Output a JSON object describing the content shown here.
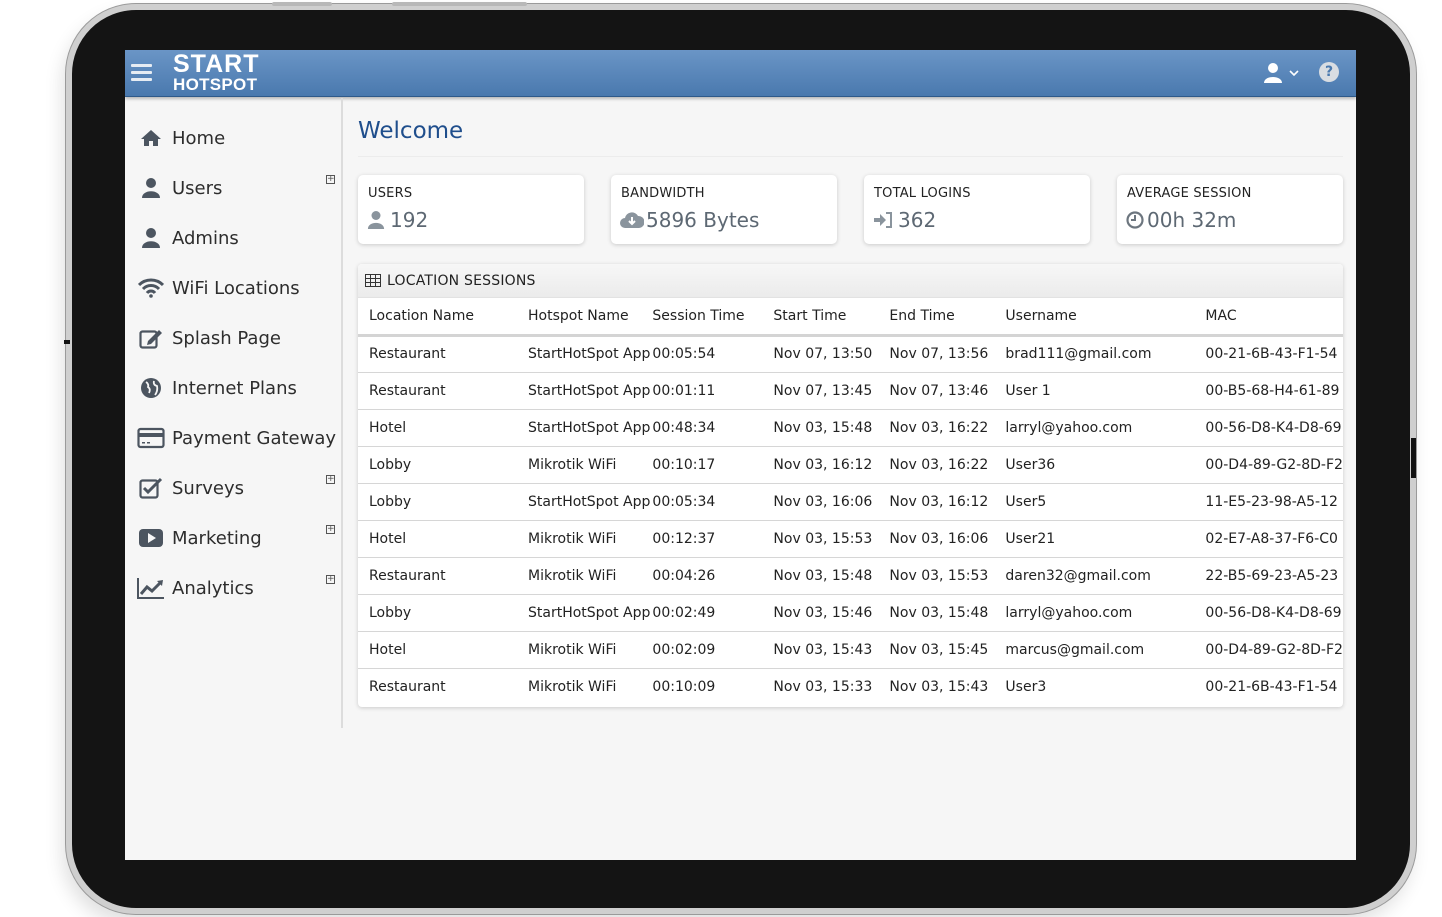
{
  "app": {
    "logo_line1": "START",
    "logo_line2": "HOTSPOT",
    "menu_icon": "hamburger-icon",
    "user_icon": "user-icon",
    "user_dropdown_icon": "chevron-down-icon",
    "help_icon": "question-circle-icon",
    "help_glyph": "?"
  },
  "sidebar": {
    "items": [
      {
        "label": "Home",
        "icon": "home-icon",
        "expandable": false
      },
      {
        "label": "Users",
        "icon": "user-icon",
        "expandable": true
      },
      {
        "label": "Admins",
        "icon": "user-icon",
        "expandable": false
      },
      {
        "label": "WiFi Locations",
        "icon": "wifi-icon",
        "expandable": false
      },
      {
        "label": "Splash Page",
        "icon": "edit-icon",
        "expandable": false
      },
      {
        "label": "Internet Plans",
        "icon": "globe-icon",
        "expandable": false
      },
      {
        "label": "Payment Gateway",
        "icon": "credit-card-icon",
        "expandable": false
      },
      {
        "label": "Surveys",
        "icon": "check-square-icon",
        "expandable": true
      },
      {
        "label": "Marketing",
        "icon": "video-play-icon",
        "expandable": true
      },
      {
        "label": "Analytics",
        "icon": "line-chart-icon",
        "expandable": true
      }
    ],
    "expand_glyph": "+"
  },
  "main": {
    "title": "Welcome",
    "stats": [
      {
        "title": "USERS",
        "value": "192",
        "icon": "user-icon"
      },
      {
        "title": "BANDWIDTH",
        "value": "5896 Bytes",
        "icon": "cloud-download-icon"
      },
      {
        "title": "TOTAL LOGINS",
        "value": "362",
        "icon": "sign-in-icon"
      },
      {
        "title": "AVERAGE SESSION",
        "value": "00h 32m",
        "icon": "clock-icon"
      }
    ],
    "sessions": {
      "title": "LOCATION SESSIONS",
      "icon": "table-icon",
      "columns": [
        "Location Name",
        "Hotspot Name",
        "Session Time",
        "Start Time",
        "End Time",
        "Username",
        "MAC"
      ],
      "rows": [
        [
          "Restaurant",
          "StartHotSpot App",
          "00:05:54",
          "Nov 07, 13:50",
          "Nov 07, 13:56",
          "brad111@gmail.com",
          "00-21-6B-43-F1-54"
        ],
        [
          "Restaurant",
          "StartHotSpot App",
          "00:01:11",
          "Nov 07, 13:45",
          "Nov 07, 13:46",
          "User 1",
          "00-B5-68-H4-61-89"
        ],
        [
          "Hotel",
          "StartHotSpot App",
          "00:48:34",
          "Nov 03, 15:48",
          "Nov 03, 16:22",
          "larryl@yahoo.com",
          "00-56-D8-K4-D8-69"
        ],
        [
          "Lobby",
          "Mikrotik WiFi",
          "00:10:17",
          "Nov 03, 16:12",
          "Nov 03, 16:22",
          "User36",
          "00-D4-89-G2-8D-F2"
        ],
        [
          "Lobby",
          "StartHotSpot App",
          "00:05:34",
          "Nov 03, 16:06",
          "Nov 03, 16:12",
          "User5",
          "11-E5-23-98-A5-12"
        ],
        [
          "Hotel",
          "Mikrotik WiFi",
          "00:12:37",
          "Nov 03, 15:53",
          "Nov 03, 16:06",
          "User21",
          "02-E7-A8-37-F6-C0"
        ],
        [
          "Restaurant",
          "Mikrotik WiFi",
          "00:04:26",
          "Nov 03, 15:48",
          "Nov 03, 15:53",
          "daren32@gmail.com",
          "22-B5-69-23-A5-23"
        ],
        [
          "Lobby",
          "StartHotSpot App",
          "00:02:49",
          "Nov 03, 15:46",
          "Nov 03, 15:48",
          "larryl@yahoo.com",
          "00-56-D8-K4-D8-69"
        ],
        [
          "Hotel",
          "Mikrotik WiFi",
          "00:02:09",
          "Nov 03, 15:43",
          "Nov 03, 15:45",
          "marcus@gmail.com",
          "00-D4-89-G2-8D-F2"
        ],
        [
          "Restaurant",
          "Mikrotik WiFi",
          "00:10:09",
          "Nov 03, 15:33",
          "Nov 03, 15:43",
          "User3",
          "00-21-6B-43-F1-54"
        ]
      ]
    }
  },
  "colors": {
    "header_blue": "#5585bb",
    "title_blue": "#1f4e8c",
    "stat_value_gray": "#5d6873"
  }
}
